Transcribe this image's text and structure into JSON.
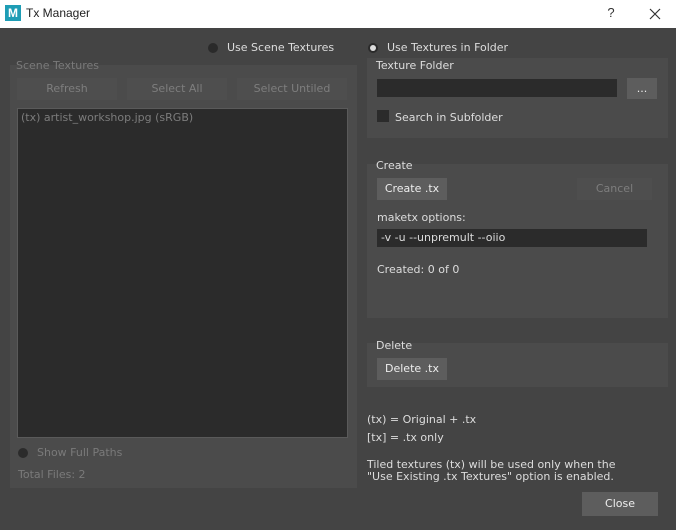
{
  "window": {
    "title": "Tx Manager",
    "help_glyph": "?",
    "app_icon_letter": "M"
  },
  "source_mode": {
    "scene_label": "Use Scene Textures",
    "folder_label": "Use Textures in Folder",
    "selected": "folder"
  },
  "scene_textures": {
    "group_label": "Scene Textures",
    "buttons": {
      "refresh": "Refresh",
      "select_all": "Select All",
      "select_untiled": "Select Untiled"
    },
    "items": [
      "(tx) artist_workshop.jpg (sRGB)"
    ],
    "show_full_paths_label": "Show Full Paths",
    "total_files": "Total Files: 2"
  },
  "texture_folder": {
    "label": "Texture Folder",
    "path_value": "",
    "browse_label": "...",
    "search_subfolder_label": "Search in Subfolder",
    "search_subfolder_checked": false
  },
  "create": {
    "section_label": "Create",
    "create_button": "Create .tx",
    "cancel_button": "Cancel",
    "options_label": "maketx options:",
    "options_value": "-v -u --unpremult --oiio",
    "status": "Created: 0 of 0"
  },
  "delete": {
    "section_label": "Delete",
    "delete_button": "Delete .tx"
  },
  "legend": {
    "line1": "(tx) = Original + .tx",
    "line2": "[tx] = .tx only",
    "note1": "Tiled textures (tx) will be used only when the",
    "note2": "\"Use Existing .tx Textures\" option is enabled."
  },
  "footer": {
    "close_label": "Close"
  },
  "colors": {
    "window_bg": "#444444",
    "panel_bg": "#4b4b4b",
    "field_bg": "#2b2b2b",
    "button_bg": "#5d5d5d",
    "app_icon": "#1e9db5"
  }
}
